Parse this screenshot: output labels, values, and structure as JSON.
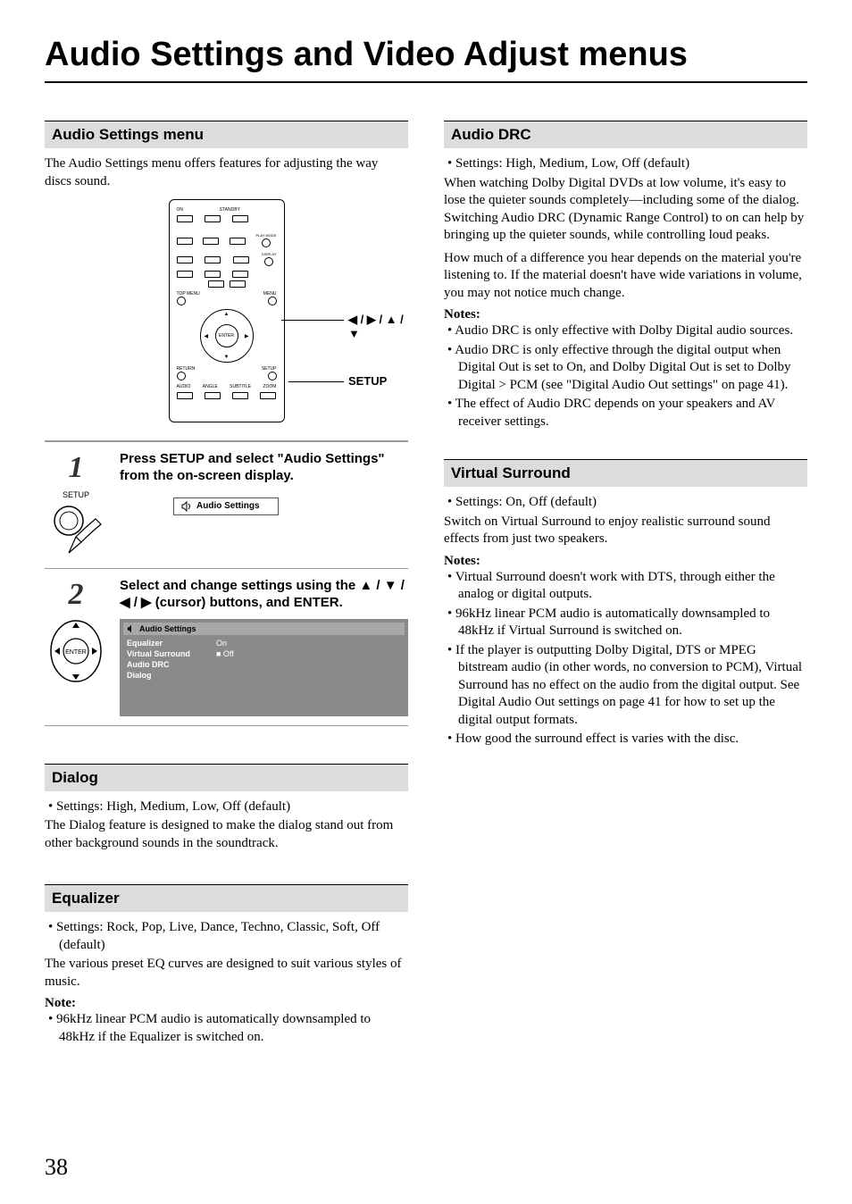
{
  "pageTitle": "Audio Settings and Video Adjust menus",
  "pageNumber": "38",
  "sections": {
    "audioSettingsMenu": {
      "header": "Audio Settings menu",
      "intro": "The Audio Settings menu offers features for adjusting the way discs sound."
    },
    "dialog": {
      "header": "Dialog",
      "bullet1": "Settings: High, Medium, Low, Off (default)",
      "para1": "The Dialog feature is designed to make the dialog stand out from other background sounds in the soundtrack."
    },
    "equalizer": {
      "header": "Equalizer",
      "bullet1": "Settings: Rock, Pop, Live, Dance, Techno, Classic, Soft, Off (default)",
      "para1": "The various preset EQ curves are designed to suit various styles of music.",
      "noteLabel": "Note:",
      "noteBullet1": "96kHz linear PCM audio is automatically downsampled to 48kHz if the Equalizer is switched on."
    },
    "audioDRC": {
      "header": "Audio DRC",
      "bullet1": "Settings: High, Medium, Low, Off (default)",
      "para1": "When watching Dolby Digital DVDs at low volume, it's easy to lose the quieter sounds completely—including some of the dialog. Switching Audio DRC (Dynamic Range Control) to on can help by bringing up the quieter sounds, while controlling loud peaks.",
      "para2": "How much of a difference you hear depends on the material you're listening to. If the material doesn't have wide variations in volume, you may not notice much change.",
      "notesLabel": "Notes:",
      "noteBullets": [
        "Audio DRC is only effective with Dolby Digital audio sources.",
        "Audio DRC is only effective through the digital output when Digital Out is set to On, and Dolby Digital Out is set to Dolby Digital > PCM (see \"Digital Audio Out settings\" on page 41).",
        "The effect of Audio DRC depends on your speakers and AV receiver settings."
      ]
    },
    "virtualSurround": {
      "header": "Virtual Surround",
      "bullet1": "Settings: On, Off (default)",
      "para1": "Switch on Virtual Surround to enjoy realistic surround sound effects from just two speakers.",
      "notesLabel": "Notes:",
      "noteBullets": [
        "Virtual Surround doesn't work with DTS, through either the analog or digital outputs.",
        "96kHz linear PCM audio is automatically downsampled to 48kHz if Virtual Surround is switched on.",
        "If the player is outputting Dolby Digital, DTS or MPEG bitstream audio (in other words, no conversion to PCM), Virtual Surround has no effect on the audio from the digital output. See Digital Audio Out settings on page 41 for how to set up the digital output formats.",
        "How good the surround effect is varies with the disc."
      ]
    }
  },
  "remote": {
    "calloutArrows": "◀ / ▶ / ▲ / ▼",
    "calloutSetup": "SETUP",
    "labels": {
      "on": "ON",
      "standby": "STANDBY",
      "playmode": "PLAY MODE",
      "display": "DISPLAY",
      "topmenu": "TOP MENU",
      "menu": "MENU",
      "return": "RETURN",
      "setup": "SETUP",
      "enter": "ENTER",
      "audio": "AUDIO",
      "angle": "ANGLE",
      "subtitle": "SUBTITLE",
      "zoom": "ZOOM"
    }
  },
  "steps": {
    "step1": {
      "num": "1",
      "iconLabel": "SETUP",
      "instruction": "Press SETUP and select \"Audio Settings\" from the on-screen display.",
      "pillLabel": "Audio Settings"
    },
    "step2": {
      "num": "2",
      "enterLabel": "ENTER",
      "instructionPrefix": "Select and change settings using the ",
      "instructionArrows": "▲ / ▼ / ◀ / ▶",
      "instructionSuffix": " (cursor) buttons, and ENTER.",
      "panel": {
        "title": "Audio Settings",
        "rows": [
          {
            "label": "Equalizer",
            "value": "On"
          },
          {
            "label": "Virtual Surround",
            "value": "■ Off"
          },
          {
            "label": "Audio DRC",
            "value": ""
          },
          {
            "label": "Dialog",
            "value": ""
          }
        ]
      }
    }
  }
}
